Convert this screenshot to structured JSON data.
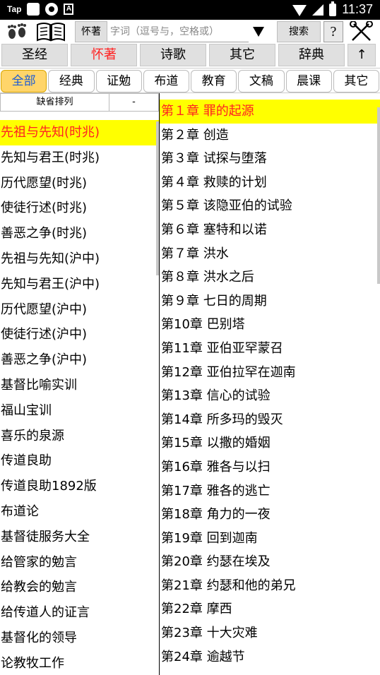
{
  "status_bar": {
    "tap_label": "Tap",
    "time": "11:37",
    "icons": [
      "app-icon",
      "sync-icon",
      "a-icon",
      "wifi-icon",
      "signal-icon",
      "battery-icon"
    ]
  },
  "toolbar": {
    "category_label": "怀著",
    "search_placeholder": "字词（逗号与，空格或）",
    "search_value": "",
    "search_button": "搜索",
    "help_label": "?",
    "icons": [
      "footprints-icon",
      "book-icon",
      "dropdown-icon",
      "tools-icon"
    ]
  },
  "main_tabs": [
    {
      "label": "圣经",
      "active": false
    },
    {
      "label": "怀著",
      "active": true
    },
    {
      "label": "诗歌",
      "active": false
    },
    {
      "label": "其它",
      "active": false
    },
    {
      "label": "辞典",
      "active": false
    },
    {
      "label": "↑",
      "active": false
    }
  ],
  "sub_tabs": [
    {
      "label": "全部",
      "active": true
    },
    {
      "label": "经典",
      "active": false
    },
    {
      "label": "证勉",
      "active": false
    },
    {
      "label": "布道",
      "active": false
    },
    {
      "label": "教育",
      "active": false
    },
    {
      "label": "文稿",
      "active": false
    },
    {
      "label": "晨课",
      "active": false
    },
    {
      "label": "其它",
      "active": false
    }
  ],
  "sort": {
    "label": "缺省排列",
    "order": "-"
  },
  "books": [
    "先祖与先知(时兆)",
    "先知与君王(时兆)",
    "历代愿望(时兆)",
    "使徒行述(时兆)",
    "善恶之争(时兆)",
    "先祖与先知(沪中)",
    "先知与君王(沪中)",
    "历代愿望(沪中)",
    "使徒行述(沪中)",
    "善恶之争(沪中)",
    "基督比喻实训",
    "福山宝训",
    "喜乐的泉源",
    "传道良助",
    "传道良助1892版",
    "布道论",
    "基督徒服务大全",
    "给管家的勉言",
    "给教会的勉言",
    "给传道人的证言",
    "基督化的领导",
    "论教牧工作"
  ],
  "selected_book": 0,
  "chapters": [
    "第１章 罪的起源",
    "第２章 创造",
    "第３章 试探与堕落",
    "第４章 救赎的计划",
    "第５章 该隐亚伯的试验",
    "第６章 塞特和以诺",
    "第７章 洪水",
    "第８章 洪水之后",
    "第９章 七日的周期",
    "第10章 巴别塔",
    "第11章 亚伯亚罕蒙召",
    "第12章 亚伯拉罕在迦南",
    "第13章 信心的试验",
    "第14章 所多玛的毁灭",
    "第15章 以撒的婚姻",
    "第16章 雅各与以扫",
    "第17章 雅各的逃亡",
    "第18章 角力的一夜",
    "第19章 回到迦南",
    "第20章 约瑟在埃及",
    "第21章 约瑟和他的弟兄",
    "第22章 摩西",
    "第23章 十大灾难",
    "第24章 逾越节"
  ],
  "selected_chapter": 0,
  "colors": {
    "highlight_bg": "#ffff00",
    "highlight_text": "#ff2222",
    "active_subtab_bg": "#ffd56a",
    "active_subtab_text": "#1a5bd6"
  }
}
